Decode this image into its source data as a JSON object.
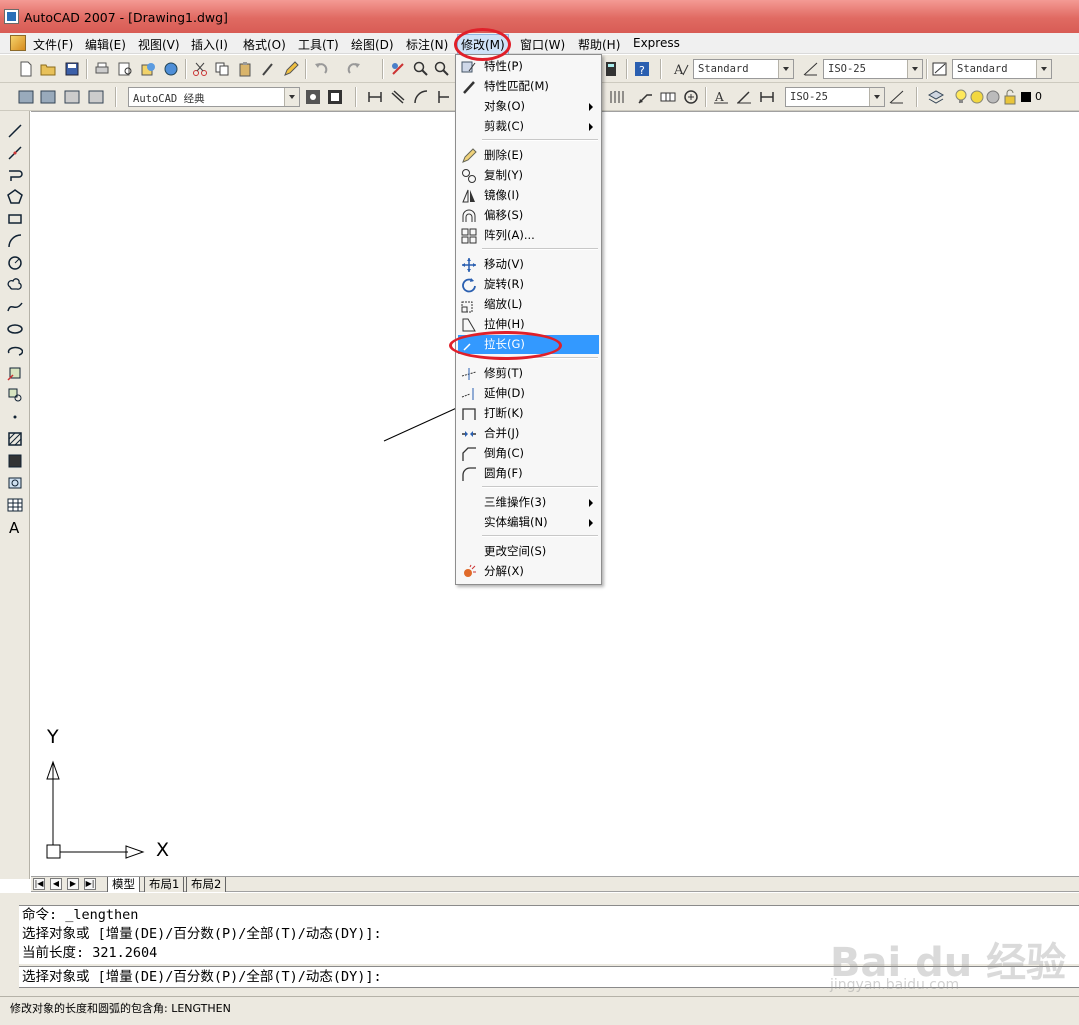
{
  "window": {
    "title": "AutoCAD 2007 - [Drawing1.dwg]"
  },
  "menubar": {
    "items": [
      "文件(F)",
      "编辑(E)",
      "视图(V)",
      "插入(I)",
      "格式(O)",
      "工具(T)",
      "绘图(D)",
      "标注(N)",
      "修改(M)",
      "窗口(W)",
      "帮助(H)",
      "Express"
    ],
    "active_index": 8
  },
  "toolbar": {
    "text_style": "Standard",
    "dim_style": "ISO-25",
    "table_style": "Standard",
    "workspace": "AutoCAD 经典",
    "dim_style_2": "ISO-25",
    "layer": "0"
  },
  "modify_menu": {
    "items": [
      {
        "label": "特性(P)",
        "icon": "properties-icon"
      },
      {
        "label": "特性匹配(M)",
        "icon": "match-properties-icon"
      },
      {
        "label": "对象(O)",
        "submenu": true
      },
      {
        "label": "剪裁(C)",
        "submenu": true
      },
      {
        "label": "删除(E)",
        "icon": "erase-icon"
      },
      {
        "label": "复制(Y)",
        "icon": "copy-icon"
      },
      {
        "label": "镜像(I)",
        "icon": "mirror-icon"
      },
      {
        "label": "偏移(S)",
        "icon": "offset-icon"
      },
      {
        "label": "阵列(A)...",
        "icon": "array-icon"
      },
      {
        "label": "移动(V)",
        "icon": "move-icon"
      },
      {
        "label": "旋转(R)",
        "icon": "rotate-icon"
      },
      {
        "label": "缩放(L)",
        "icon": "scale-icon"
      },
      {
        "label": "拉伸(H)",
        "icon": "stretch-icon"
      },
      {
        "label": "拉长(G)",
        "icon": "lengthen-icon",
        "highlighted": true
      },
      {
        "label": "修剪(T)",
        "icon": "trim-icon"
      },
      {
        "label": "延伸(D)",
        "icon": "extend-icon"
      },
      {
        "label": "打断(K)",
        "icon": "break-icon"
      },
      {
        "label": "合并(J)",
        "icon": "join-icon"
      },
      {
        "label": "倒角(C)",
        "icon": "chamfer-icon"
      },
      {
        "label": "圆角(F)",
        "icon": "fillet-icon"
      },
      {
        "label": "三维操作(3)",
        "submenu": true
      },
      {
        "label": "实体编辑(N)",
        "submenu": true
      },
      {
        "label": "更改空间(S)"
      },
      {
        "label": "分解(X)",
        "icon": "explode-icon"
      }
    ]
  },
  "ucs": {
    "y_label": "Y",
    "x_label": "X"
  },
  "layout_tabs": [
    "模型",
    "布局1",
    "布局2"
  ],
  "command": {
    "history": [
      "命令: _lengthen",
      "选择对象或 [增量(DE)/百分数(P)/全部(T)/动态(DY)]:",
      "当前长度: 321.2604"
    ],
    "prompt": "选择对象或 [增量(DE)/百分数(P)/全部(T)/动态(DY)]:"
  },
  "status": {
    "text": "修改对象的长度和圆弧的包含角:  LENGTHEN"
  },
  "watermark": {
    "main": "Bai du 经验",
    "sub": "jingyan.baidu.com"
  },
  "colors": {
    "highlight": "#3399ff",
    "annotation": "#e0202a",
    "titlebar": "#e06a62"
  }
}
